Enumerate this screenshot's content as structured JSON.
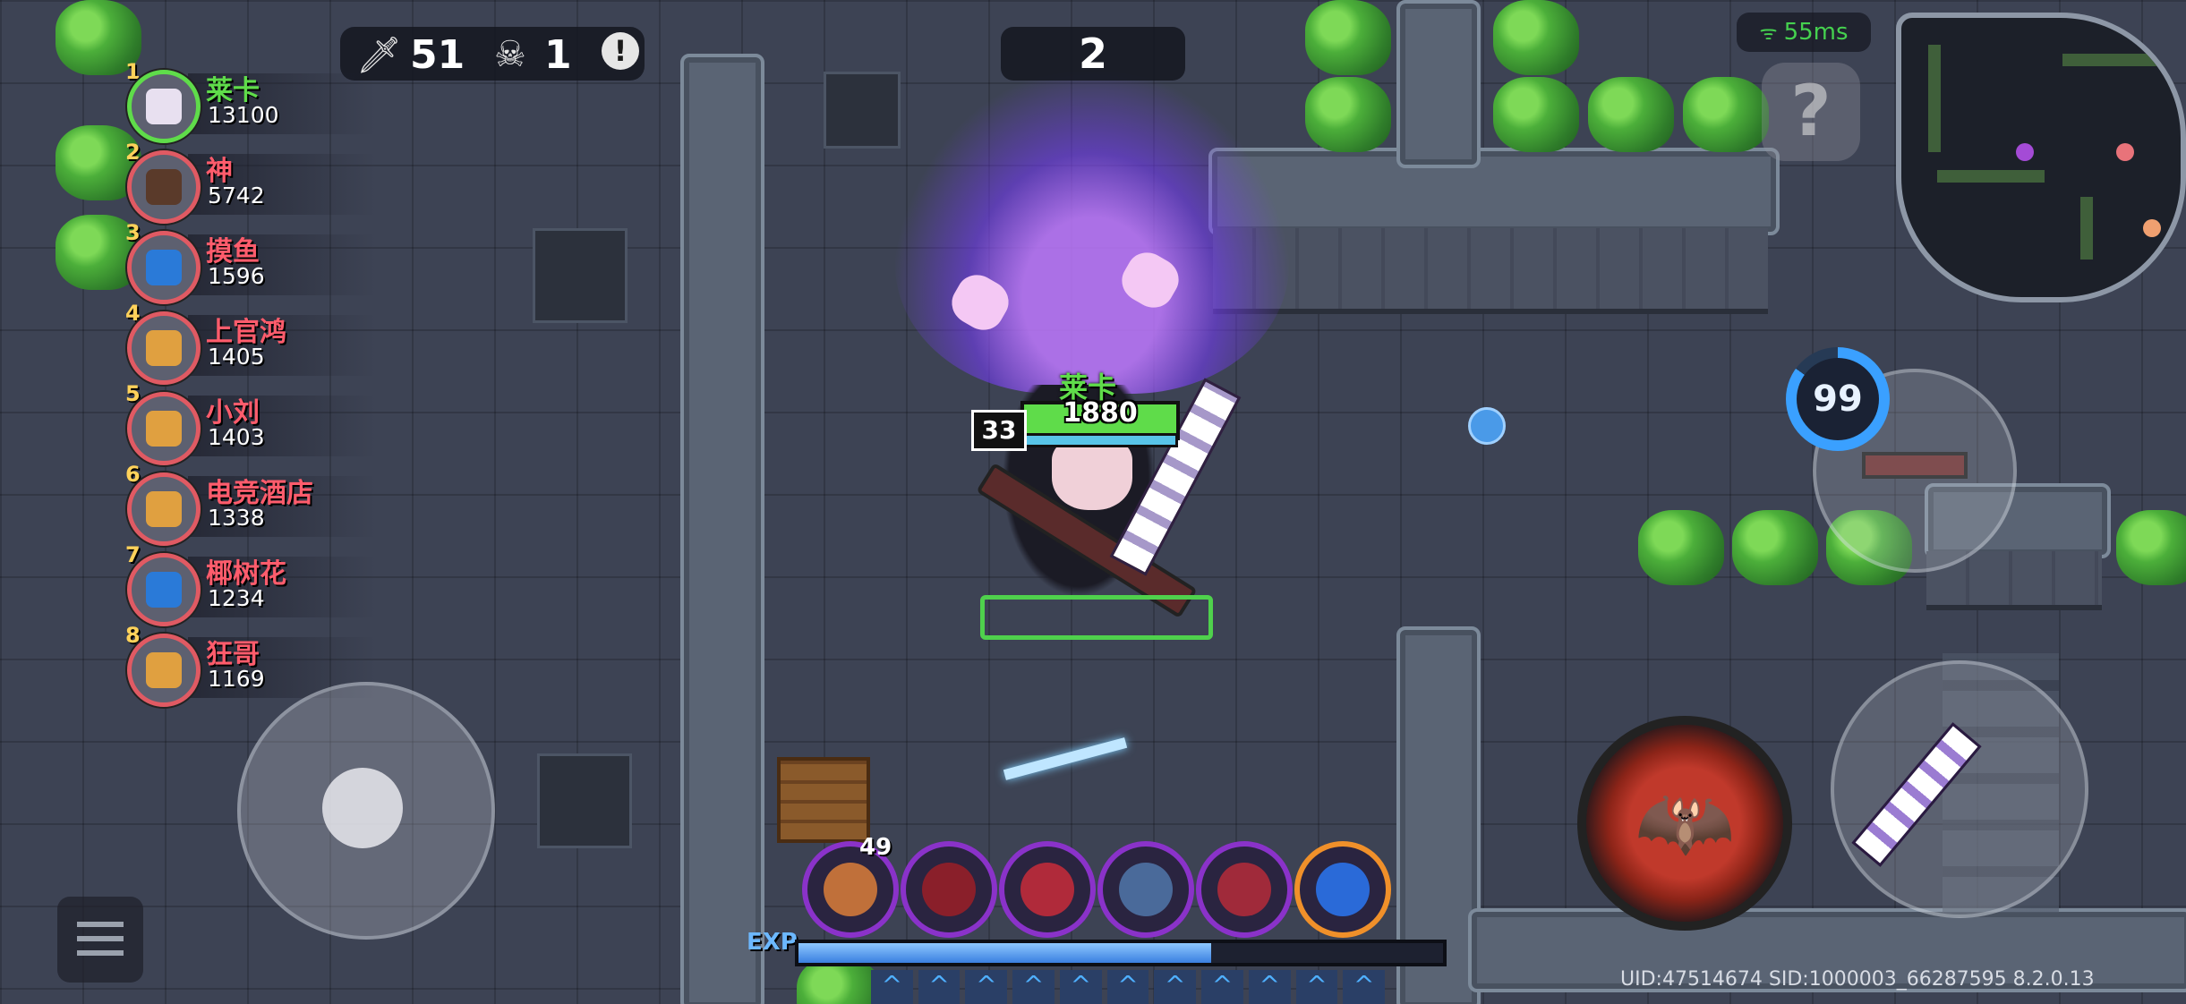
{
  "hud": {
    "kills": "51",
    "deaths": "1",
    "round": "2",
    "ping": "55ms",
    "help_label": "?",
    "ammo": "99",
    "kills_icon": "sword-icon",
    "deaths_icon": "skull-icon",
    "alert_icon": "exclamation-icon"
  },
  "player": {
    "name": "莱卡",
    "hp": "1880",
    "level": "33"
  },
  "leaderboard": [
    {
      "rank": "1",
      "name": "莱卡",
      "score": "13100"
    },
    {
      "rank": "2",
      "name": "神",
      "score": "5742"
    },
    {
      "rank": "3",
      "name": "摸鱼",
      "score": "1596"
    },
    {
      "rank": "4",
      "name": "上官鸿",
      "score": "1405"
    },
    {
      "rank": "5",
      "name": "小刘",
      "score": "1403"
    },
    {
      "rank": "6",
      "name": "电竞酒店",
      "score": "1338"
    },
    {
      "rank": "7",
      "name": "椰树花",
      "score": "1234"
    },
    {
      "rank": "8",
      "name": "狂哥",
      "score": "1169"
    }
  ],
  "abilities": {
    "first_count": "49"
  },
  "exp": {
    "label": "EXP",
    "progress": 0.64
  },
  "footer": {
    "uid": "UID:47514674 SID:1000003_66287595 8.2.0.13"
  },
  "colors": {
    "ally_green": "#5fdc4a",
    "enemy_red": "#ff5c6c",
    "ping_green": "#45d14f",
    "ammo_blue": "#3aa0ff",
    "exp_blue": "#3a7fe0"
  }
}
